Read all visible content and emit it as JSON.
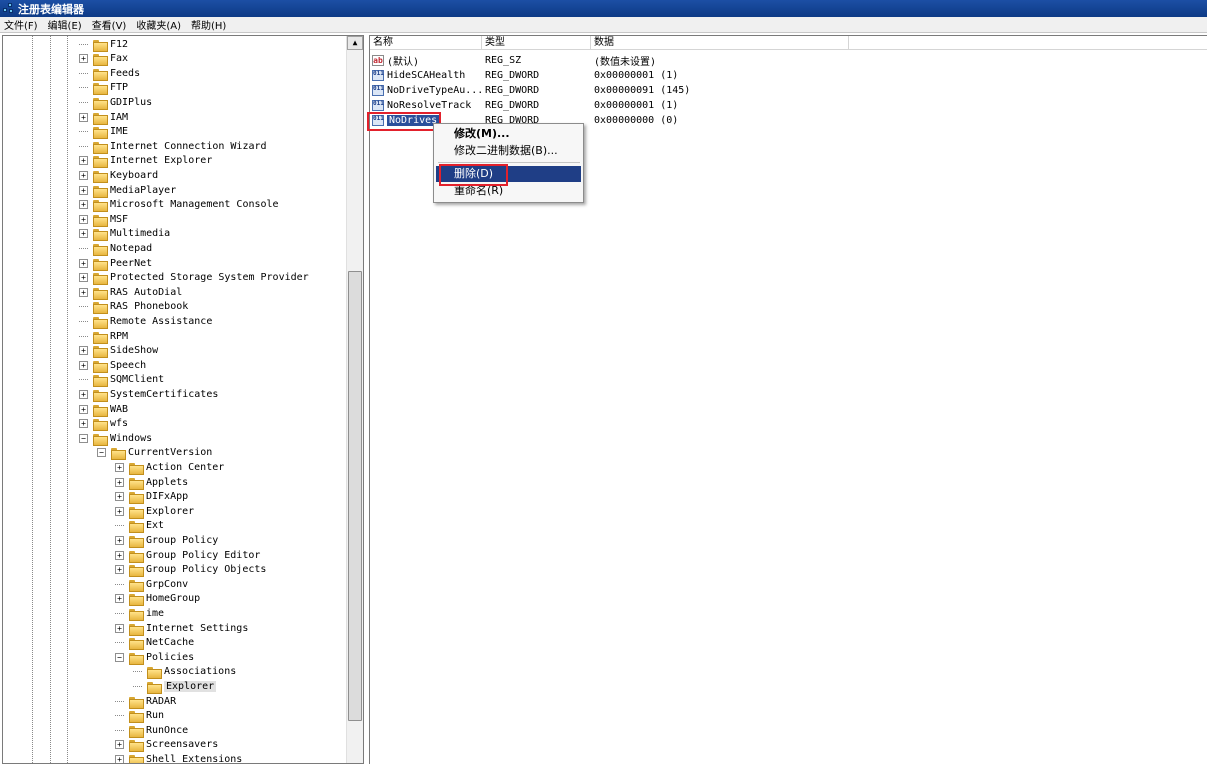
{
  "window": {
    "title": "注册表编辑器"
  },
  "menubar": [
    "文件(F)",
    "编辑(E)",
    "查看(V)",
    "收藏夹(A)",
    "帮助(H)"
  ],
  "tree": {
    "items": [
      {
        "label": "F12",
        "level": 1,
        "expander": "none"
      },
      {
        "label": "Fax",
        "level": 1,
        "expander": "plus"
      },
      {
        "label": "Feeds",
        "level": 1,
        "expander": "none"
      },
      {
        "label": "FTP",
        "level": 1,
        "expander": "none"
      },
      {
        "label": "GDIPlus",
        "level": 1,
        "expander": "none"
      },
      {
        "label": "IAM",
        "level": 1,
        "expander": "plus"
      },
      {
        "label": "IME",
        "level": 1,
        "expander": "none"
      },
      {
        "label": "Internet Connection Wizard",
        "level": 1,
        "expander": "none"
      },
      {
        "label": "Internet Explorer",
        "level": 1,
        "expander": "plus"
      },
      {
        "label": "Keyboard",
        "level": 1,
        "expander": "plus"
      },
      {
        "label": "MediaPlayer",
        "level": 1,
        "expander": "plus"
      },
      {
        "label": "Microsoft Management Console",
        "level": 1,
        "expander": "plus"
      },
      {
        "label": "MSF",
        "level": 1,
        "expander": "plus"
      },
      {
        "label": "Multimedia",
        "level": 1,
        "expander": "plus"
      },
      {
        "label": "Notepad",
        "level": 1,
        "expander": "none"
      },
      {
        "label": "PeerNet",
        "level": 1,
        "expander": "plus"
      },
      {
        "label": "Protected Storage System Provider",
        "level": 1,
        "expander": "plus"
      },
      {
        "label": "RAS AutoDial",
        "level": 1,
        "expander": "plus"
      },
      {
        "label": "RAS Phonebook",
        "level": 1,
        "expander": "none"
      },
      {
        "label": "Remote Assistance",
        "level": 1,
        "expander": "none"
      },
      {
        "label": "RPM",
        "level": 1,
        "expander": "none"
      },
      {
        "label": "SideShow",
        "level": 1,
        "expander": "plus"
      },
      {
        "label": "Speech",
        "level": 1,
        "expander": "plus"
      },
      {
        "label": "SQMClient",
        "level": 1,
        "expander": "none"
      },
      {
        "label": "SystemCertificates",
        "level": 1,
        "expander": "plus"
      },
      {
        "label": "WAB",
        "level": 1,
        "expander": "plus"
      },
      {
        "label": "wfs",
        "level": 1,
        "expander": "plus"
      },
      {
        "label": "Windows",
        "level": 1,
        "expander": "minus"
      },
      {
        "label": "CurrentVersion",
        "level": 2,
        "expander": "minus"
      },
      {
        "label": "Action Center",
        "level": 3,
        "expander": "plus"
      },
      {
        "label": "Applets",
        "level": 3,
        "expander": "plus"
      },
      {
        "label": "DIFxApp",
        "level": 3,
        "expander": "plus"
      },
      {
        "label": "Explorer",
        "level": 3,
        "expander": "plus"
      },
      {
        "label": "Ext",
        "level": 3,
        "expander": "none"
      },
      {
        "label": "Group Policy",
        "level": 3,
        "expander": "plus"
      },
      {
        "label": "Group Policy Editor",
        "level": 3,
        "expander": "plus"
      },
      {
        "label": "Group Policy Objects",
        "level": 3,
        "expander": "plus"
      },
      {
        "label": "GrpConv",
        "level": 3,
        "expander": "none"
      },
      {
        "label": "HomeGroup",
        "level": 3,
        "expander": "plus"
      },
      {
        "label": "ime",
        "level": 3,
        "expander": "none"
      },
      {
        "label": "Internet Settings",
        "level": 3,
        "expander": "plus"
      },
      {
        "label": "NetCache",
        "level": 3,
        "expander": "none"
      },
      {
        "label": "Policies",
        "level": 3,
        "expander": "minus"
      },
      {
        "label": "Associations",
        "level": 4,
        "expander": "none"
      },
      {
        "label": "Explorer",
        "level": 4,
        "expander": "none",
        "selected": true
      },
      {
        "label": "RADAR",
        "level": 3,
        "expander": "none"
      },
      {
        "label": "Run",
        "level": 3,
        "expander": "none"
      },
      {
        "label": "RunOnce",
        "level": 3,
        "expander": "none"
      },
      {
        "label": "Screensavers",
        "level": 3,
        "expander": "plus"
      },
      {
        "label": "Shell Extensions",
        "level": 3,
        "expander": "plus"
      }
    ]
  },
  "list": {
    "columns": [
      "名称",
      "类型",
      "数据"
    ],
    "rows": [
      {
        "name": "(默认)",
        "type": "REG_SZ",
        "data": "(数值未设置)",
        "icon": "string-value-icon"
      },
      {
        "name": "HideSCAHealth",
        "type": "REG_DWORD",
        "data": "0x00000001 (1)",
        "icon": "dword-value-icon"
      },
      {
        "name": "NoDriveTypeAu...",
        "type": "REG_DWORD",
        "data": "0x00000091 (145)",
        "icon": "dword-value-icon"
      },
      {
        "name": "NoResolveTrack",
        "type": "REG_DWORD",
        "data": "0x00000001 (1)",
        "icon": "dword-value-icon"
      },
      {
        "name": "NoDrives",
        "type": "REG_DWORD",
        "data": "0x00000000 (0)",
        "icon": "dword-value-icon",
        "selected": true
      }
    ]
  },
  "context_menu": {
    "items": [
      "修改(M)...",
      "修改二进制数据(B)...",
      "删除(D)",
      "重命名(R)"
    ],
    "highlight_color": "#1f3e86"
  },
  "annotation_color": "#e2212c"
}
